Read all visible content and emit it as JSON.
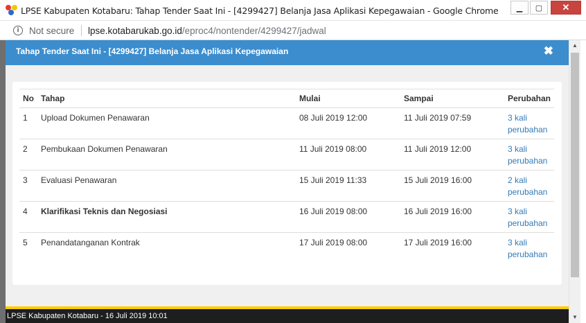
{
  "window": {
    "title": "LPSE Kabupaten Kotabaru: Tahap Tender Saat Ini - [4299427] Belanja Jasa Aplikasi Kepegawaian - Google Chrome",
    "minimize_icon": "minimize-icon",
    "maximize_icon": "maximize-icon",
    "close_icon": "close-icon"
  },
  "address_bar": {
    "security_label": "Not secure",
    "url_host": "lpse.kotabarukab.go.id",
    "url_path": "/eproc4/nontender/4299427/jadwal"
  },
  "modal": {
    "title": "Tahap Tender Saat Ini - [4299427] Belanja Jasa Aplikasi Kepegawaian",
    "close_symbol": "✖"
  },
  "table": {
    "headers": [
      "No",
      "Tahap",
      "Mulai",
      "Sampai",
      "Perubahan"
    ],
    "rows": [
      {
        "no": "1",
        "tahap": "Upload Dokumen Penawaran",
        "mulai": "08 Juli 2019 12:00",
        "sampai": "11 Juli 2019 07:59",
        "perubahan_1": "3 kali",
        "perubahan_2": "perubahan",
        "bold": false
      },
      {
        "no": "2",
        "tahap": "Pembukaan Dokumen Penawaran",
        "mulai": "11 Juli 2019 08:00",
        "sampai": "11 Juli 2019 12:00",
        "perubahan_1": "3 kali",
        "perubahan_2": "perubahan",
        "bold": false
      },
      {
        "no": "3",
        "tahap": "Evaluasi Penawaran",
        "mulai": "15 Juli 2019 11:33",
        "sampai": "15 Juli 2019 16:00",
        "perubahan_1": "2 kali",
        "perubahan_2": "perubahan",
        "bold": false
      },
      {
        "no": "4",
        "tahap": "Klarifikasi Teknis dan Negosiasi",
        "mulai": "16 Juli 2019 08:00",
        "sampai": "16 Juli 2019 16:00",
        "perubahan_1": "3 kali",
        "perubahan_2": "perubahan",
        "bold": true
      },
      {
        "no": "5",
        "tahap": "Penandatanganan Kontrak",
        "mulai": "17 Juli 2019 08:00",
        "sampai": "17 Juli 2019 16:00",
        "perubahan_1": "3 kali",
        "perubahan_2": "perubahan",
        "bold": false
      }
    ]
  },
  "footer": {
    "text": "LPSE Kabupaten Kotabaru - 16 Juli 2019 10:01"
  },
  "colors": {
    "modal_header": "#3c8dcd",
    "link": "#337ab7",
    "footer_yellow": "#ffcc00",
    "footer_dark": "#1e1e1e"
  }
}
